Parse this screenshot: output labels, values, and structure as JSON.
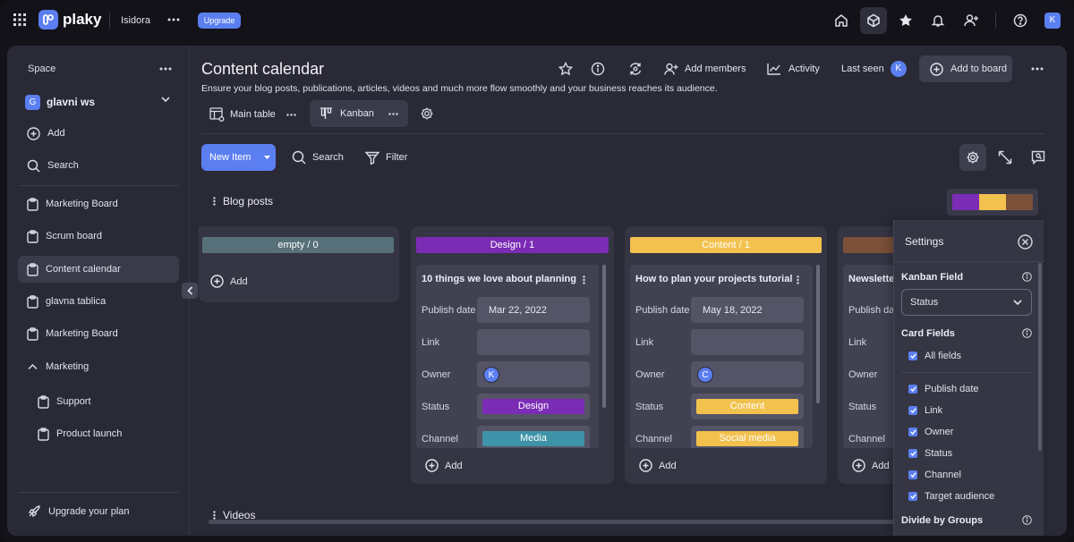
{
  "topbar": {
    "brand": "plaky",
    "workspace": "Isidora",
    "upgrade": "Upgrade",
    "avatar": "K"
  },
  "sidebar": {
    "space_label": "Space",
    "workspace_initial": "G",
    "workspace_name": "glavni ws",
    "add": "Add",
    "search": "Search",
    "items": [
      {
        "label": "Marketing Board"
      },
      {
        "label": "Scrum board"
      },
      {
        "label": "Content calendar"
      },
      {
        "label": "glavna tablica"
      },
      {
        "label": "Marketing Board"
      }
    ],
    "folder": "Marketing",
    "folder_items": [
      {
        "label": "Support"
      },
      {
        "label": "Product launch"
      }
    ],
    "upgrade_plan": "Upgrade your plan"
  },
  "board": {
    "title": "Content calendar",
    "description": "Ensure your blog posts, publications, articles, videos and much more flow smoothly and your business reaches its audience.",
    "add_members": "Add members",
    "activity": "Activity",
    "last_seen": "Last seen",
    "last_seen_avatar": "K",
    "add_to_board": "Add to board"
  },
  "views": {
    "main_table": "Main table",
    "kanban": "Kanban"
  },
  "toolbar": {
    "new_item": "New Item",
    "search": "Search",
    "filter": "Filter"
  },
  "groups": {
    "blog_posts": "Blog posts",
    "videos": "Videos"
  },
  "color_strip": [
    "#7b2cb5",
    "#f2c14e",
    "#7a5138"
  ],
  "columns": [
    {
      "label": "empty / 0",
      "color": "#57707a",
      "add": "Add"
    },
    {
      "label": "Design / 1",
      "color": "#7b2cb5",
      "add": "Add",
      "card": {
        "title": "10 things we love about planning",
        "publish_date": "Mar 22, 2022",
        "owner_initial": "K",
        "status": "Design",
        "status_color": "#7b2cb5",
        "channel": "Media",
        "channel_color": "#3e93a8"
      }
    },
    {
      "label": "Content / 1",
      "color": "#f2c14e",
      "add": "Add",
      "card": {
        "title": "How to plan your projects tutorial",
        "publish_date": "May 18, 2022",
        "owner_initial": "C",
        "status": "Content",
        "status_color": "#f2c14e",
        "channel": "Social media",
        "channel_color": "#f2c14e"
      }
    },
    {
      "label": "",
      "color": "#7a5138",
      "add": "Add",
      "card": {
        "title": "Newsletter"
      }
    }
  ],
  "card_labels": {
    "publish_date": "Publish date",
    "link": "Link",
    "owner": "Owner",
    "status": "Status",
    "channel": "Channel"
  },
  "card_labels_cut": {
    "publish_date": "Publish da"
  },
  "settings": {
    "title": "Settings",
    "kanban_field": "Kanban Field",
    "kanban_field_value": "Status",
    "card_fields": "Card Fields",
    "all_fields": "All fields",
    "fields": [
      {
        "label": "Publish date"
      },
      {
        "label": "Link"
      },
      {
        "label": "Owner"
      },
      {
        "label": "Status"
      },
      {
        "label": "Channel"
      },
      {
        "label": "Target audience"
      }
    ],
    "divide_by_groups": "Divide by Groups",
    "accent": "#5b7ff0"
  }
}
